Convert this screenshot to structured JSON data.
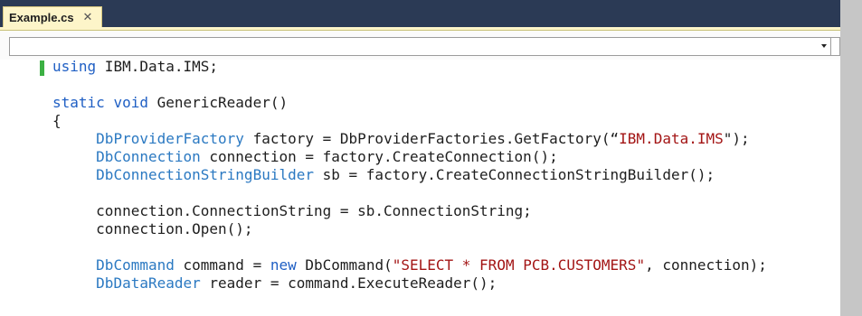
{
  "tab": {
    "title": "Example.cs",
    "close_glyph": "✕"
  },
  "navigation": {
    "member_dropdown_value": ""
  },
  "code_lines": [
    [
      {
        "t": "using",
        "c": "kw"
      },
      {
        "t": " IBM.Data.IMS;",
        "c": ""
      }
    ],
    [],
    [
      {
        "t": "static",
        "c": "kw"
      },
      {
        "t": " ",
        "c": ""
      },
      {
        "t": "void",
        "c": "kw"
      },
      {
        "t": " GenericReader()",
        "c": ""
      }
    ],
    [
      {
        "t": "{",
        "c": ""
      }
    ],
    [
      {
        "t": "     ",
        "c": ""
      },
      {
        "t": "DbProviderFactory",
        "c": "ty"
      },
      {
        "t": " factory = DbProviderFactories.GetFactory(“",
        "c": ""
      },
      {
        "t": "IBM.Data.IMS",
        "c": "str"
      },
      {
        "t": "\");",
        "c": ""
      }
    ],
    [
      {
        "t": "     ",
        "c": ""
      },
      {
        "t": "DbConnection",
        "c": "ty"
      },
      {
        "t": " connection = factory.CreateConnection();",
        "c": ""
      }
    ],
    [
      {
        "t": "     ",
        "c": ""
      },
      {
        "t": "DbConnectionStringBuilder",
        "c": "ty"
      },
      {
        "t": " sb = factory.CreateConnectionStringBuilder();",
        "c": ""
      }
    ],
    [],
    [
      {
        "t": "     connection.ConnectionString = sb.ConnectionString;",
        "c": ""
      }
    ],
    [
      {
        "t": "     connection.Open();",
        "c": ""
      }
    ],
    [],
    [
      {
        "t": "     ",
        "c": ""
      },
      {
        "t": "DbCommand",
        "c": "ty"
      },
      {
        "t": " command = ",
        "c": ""
      },
      {
        "t": "new",
        "c": "kw"
      },
      {
        "t": " DbCommand(",
        "c": ""
      },
      {
        "t": "\"SELECT * FROM PCB.CUSTOMERS\"",
        "c": "str"
      },
      {
        "t": ", connection);",
        "c": ""
      }
    ],
    [
      {
        "t": "     ",
        "c": ""
      },
      {
        "t": "DbDataReader",
        "c": "ty"
      },
      {
        "t": " reader = command.ExecuteReader();",
        "c": ""
      }
    ]
  ],
  "colors": {
    "keyword": "#1f5fc4",
    "type": "#2b79c2",
    "string": "#a31515",
    "text": "#1e1e1e",
    "tab_active": "#fdf5c9",
    "title_bar": "#2b3a55",
    "change_marker": "#3cb043",
    "scrollbar": "#c6c6c6"
  },
  "icons": {
    "tab_close": "close-icon",
    "dropdown": "chevron-down-icon"
  }
}
